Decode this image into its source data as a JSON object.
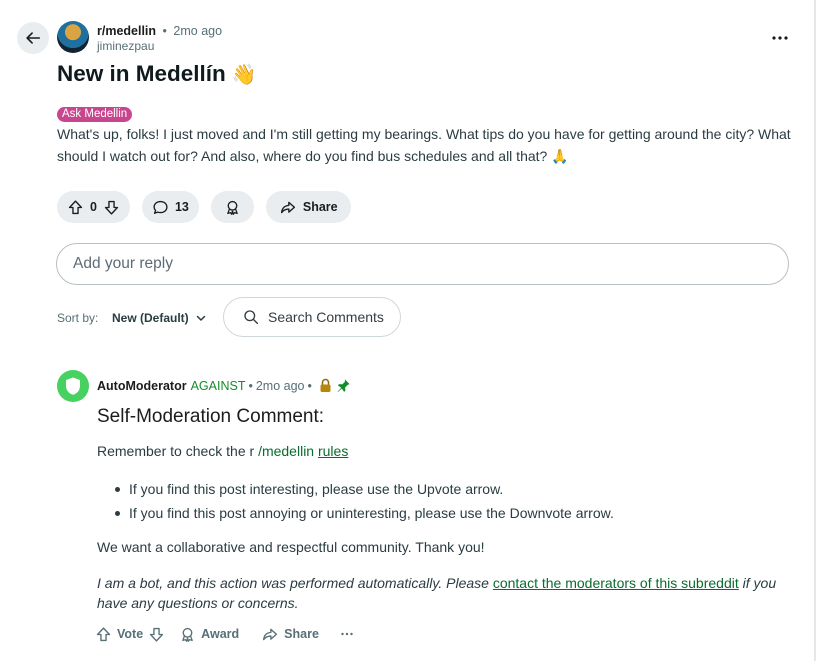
{
  "post": {
    "subreddit": "r/medellin",
    "separator": "•",
    "time": "2mo ago",
    "username": "jiminezpau",
    "title": "New in Medellín",
    "title_emoji": "👋",
    "flair": "Ask Medellin",
    "body": "What's up, folks! I just moved and I'm still getting my bearings. What tips do you have for getting around the city? What should I watch out for? And also, where do you find bus schedules and all that? 🙏",
    "vote_count": "0",
    "comment_count": "13",
    "share_label": "Share",
    "more_label": "•••"
  },
  "reply": {
    "placeholder": "Add your reply"
  },
  "sort": {
    "label": "Sort by:",
    "value": "New (Default)"
  },
  "search": {
    "label": "Search Comments"
  },
  "comment": {
    "author": "AutoModerator",
    "flag": "AGAINST",
    "separator": "•",
    "time": "2mo ago",
    "heading": "Self-Moderation Comment:",
    "line1_prefix": "Remember to check the r ",
    "line1_sub": "/medellin",
    "line1_link": "rules",
    "bullets": [
      "If you find this post interesting, please use the Upvote arrow.",
      "If you find this post annoying or uninteresting, please use the Downvote arrow."
    ],
    "line2": "We want a collaborative and respectful community. Thank you!",
    "bot_note_prefix": "I am a bot, and this action was performed automatically. Please ",
    "bot_note_link": "contact the moderators of this subreddit",
    "bot_note_suffix": " if you have any questions or concerns.",
    "actions": {
      "vote": "Vote",
      "award": "Award",
      "share": "Share",
      "more": "•••"
    }
  },
  "colors": {
    "flair": "#c7468e",
    "mod_green": "#46d160",
    "against_green": "#118d2a",
    "lock_gold": "#b8860b"
  },
  "icons": [
    "back-arrow-icon",
    "more-icon",
    "upvote-icon",
    "downvote-icon",
    "comment-icon",
    "award-icon",
    "share-icon",
    "search-icon",
    "chevron-down-icon",
    "shield-icon",
    "lock-icon",
    "pin-icon"
  ]
}
